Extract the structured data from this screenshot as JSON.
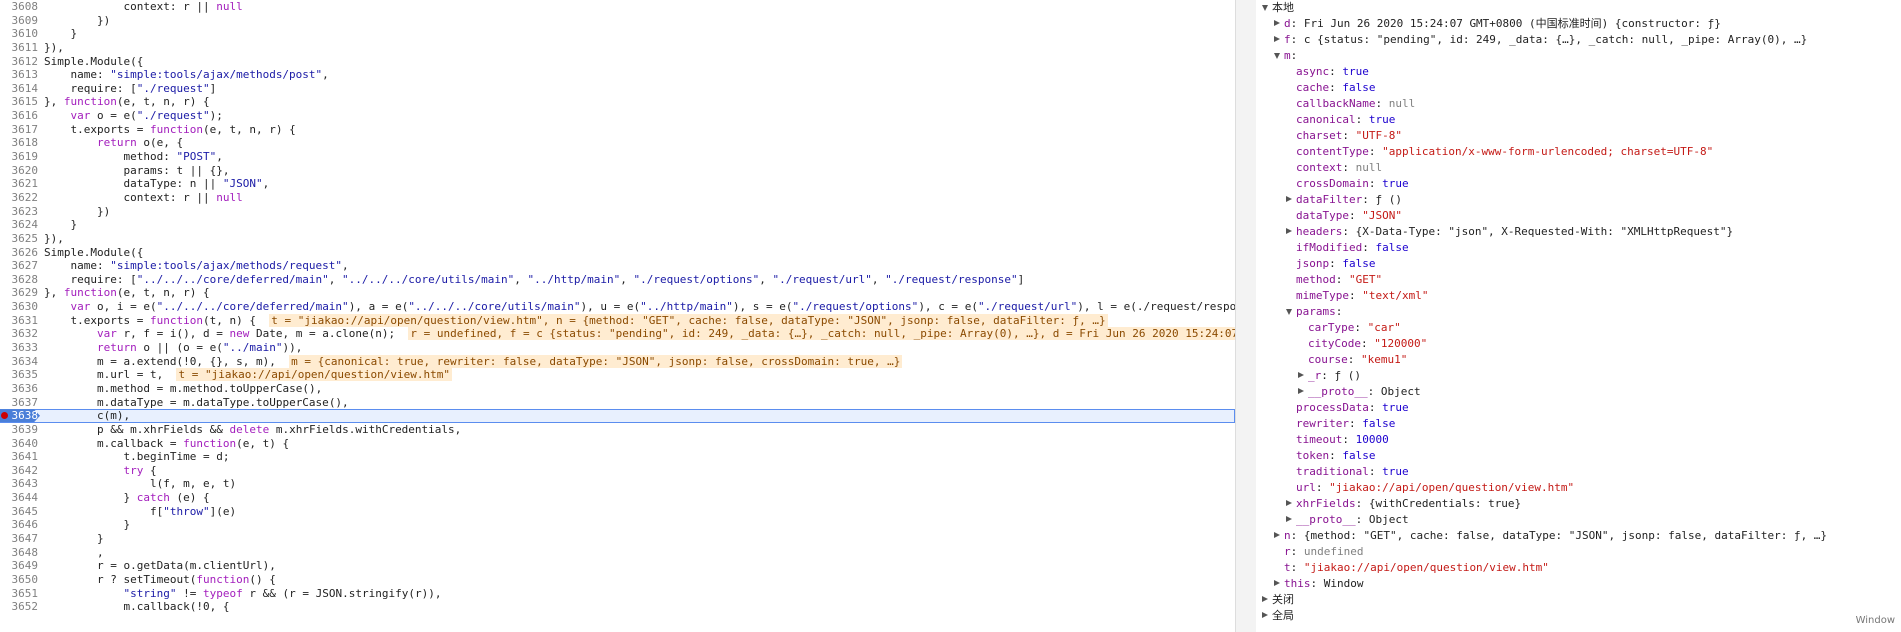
{
  "editor": {
    "current_line": 3638,
    "lines": [
      {
        "n": "3608",
        "t": "            context: r || null"
      },
      {
        "n": "3609",
        "t": "        })"
      },
      {
        "n": "3610",
        "t": "    }"
      },
      {
        "n": "3611",
        "t": "}),"
      },
      {
        "n": "3612",
        "t": "Simple.Module({"
      },
      {
        "n": "3613",
        "t": "    name: \"simple:tools/ajax/methods/post\","
      },
      {
        "n": "3614",
        "t": "    require: [\"./request\"]"
      },
      {
        "n": "3615",
        "t": "}, function(e, t, n, r) {"
      },
      {
        "n": "3616",
        "t": "    var o = e(\"./request\");"
      },
      {
        "n": "3617",
        "t": "    t.exports = function(e, t, n, r) {"
      },
      {
        "n": "3618",
        "t": "        return o(e, {"
      },
      {
        "n": "3619",
        "t": "            method: \"POST\","
      },
      {
        "n": "3620",
        "t": "            params: t || {},"
      },
      {
        "n": "3621",
        "t": "            dataType: n || \"JSON\","
      },
      {
        "n": "3622",
        "t": "            context: r || null"
      },
      {
        "n": "3623",
        "t": "        })"
      },
      {
        "n": "3624",
        "t": "    }"
      },
      {
        "n": "3625",
        "t": "}),"
      },
      {
        "n": "3626",
        "t": "Simple.Module({"
      },
      {
        "n": "3627",
        "t": "    name: \"simple:tools/ajax/methods/request\","
      },
      {
        "n": "3628",
        "t": "    require: [\"../../../core/deferred/main\", \"../../../core/utils/main\", \"../http/main\", \"./request/options\", \"./request/url\", \"./request/response\"]"
      },
      {
        "n": "3629",
        "t": "}, function(e, t, n, r) {"
      },
      {
        "n": "3630",
        "t": "    var o, i = e(\"../../../core/deferred/main\"), a = e(\"../../../core/utils/main\"), u = e(\"../http/main\"), s = e(\"./request/options\"), c = e(\"./request/url\"), l = e(\"./request/respo"
      },
      {
        "n": "3631",
        "t": "    t.exports = function(t, n) {  ",
        "i": "t = \"jiakao://api/open/question/view.htm\", n = {method: \"GET\", cache: false, dataType: \"JSON\", jsonp: false, dataFilter: ƒ, …}"
      },
      {
        "n": "3632",
        "t": "        var r, f = i(), d = new Date, m = a.clone(n);  ",
        "i": "r = undefined, f = c {status: \"pending\", id: 249, _data: {…}, _catch: null, _pipe: Array(0), …}, d = Fri Jun 26 2020 15:24:07"
      },
      {
        "n": "3633",
        "t": "        return o || (o = e(\"../main\")),"
      },
      {
        "n": "3634",
        "t": "        m = a.extend(!0, {}, s, m),  ",
        "i": "m = {canonical: true, rewriter: false, dataType: \"JSON\", jsonp: false, crossDomain: true, …}"
      },
      {
        "n": "3635",
        "t": "        m.url = t,  ",
        "i": "t = \"jiakao://api/open/question/view.htm\""
      },
      {
        "n": "3636",
        "t": "        m.method = m.method.toUpperCase(),"
      },
      {
        "n": "3637",
        "t": "        m.dataType = m.dataType.toUpperCase(),"
      },
      {
        "n": "3638",
        "t": "        c(m),"
      },
      {
        "n": "3639",
        "t": "        p && m.xhrFields && delete m.xhrFields.withCredentials,"
      },
      {
        "n": "3640",
        "t": "        m.callback = function(e, t) {"
      },
      {
        "n": "3641",
        "t": "            t.beginTime = d;"
      },
      {
        "n": "3642",
        "t": "            try {"
      },
      {
        "n": "3643",
        "t": "                l(f, m, e, t)"
      },
      {
        "n": "3644",
        "t": "            } catch (e) {"
      },
      {
        "n": "3645",
        "t": "                f[\"throw\"](e)"
      },
      {
        "n": "3646",
        "t": "            }"
      },
      {
        "n": "3647",
        "t": "        }"
      },
      {
        "n": "3648",
        "t": "        ,"
      },
      {
        "n": "3649",
        "t": "        r = o.getData(m.clientUrl),"
      },
      {
        "n": "3650",
        "t": "        r ? setTimeout(function() {"
      },
      {
        "n": "3651",
        "t": "            \"string\" != typeof r && (r = JSON.stringify(r)),"
      },
      {
        "n": "3652",
        "t": "            m.callback(!0, {"
      }
    ]
  },
  "scope": {
    "rows": [
      {
        "d": 0,
        "tri": "open",
        "k": "本地",
        "sec": true
      },
      {
        "d": 1,
        "tri": "closed",
        "k": "d",
        "v": "Fri Jun 26 2020 15:24:07 GMT+0800 (中国标准时间) {constructor: ƒ}",
        "vt": "obj"
      },
      {
        "d": 1,
        "tri": "closed",
        "k": "f",
        "v": "c {status: \"pending\", id: 249, _data: {…}, _catch: null, _pipe: Array(0), …}",
        "vt": "obj"
      },
      {
        "d": 1,
        "tri": "open",
        "k": "m",
        "v": "",
        "vt": "obj"
      },
      {
        "d": 2,
        "tri": "none",
        "k": "async",
        "v": "true",
        "vt": "bool"
      },
      {
        "d": 2,
        "tri": "none",
        "k": "cache",
        "v": "false",
        "vt": "bool"
      },
      {
        "d": 2,
        "tri": "none",
        "k": "callbackName",
        "v": "null",
        "vt": "obj"
      },
      {
        "d": 2,
        "tri": "none",
        "k": "canonical",
        "v": "true",
        "vt": "bool"
      },
      {
        "d": 2,
        "tri": "none",
        "k": "charset",
        "v": "\"UTF-8\"",
        "vt": "str"
      },
      {
        "d": 2,
        "tri": "none",
        "k": "contentType",
        "v": "\"application/x-www-form-urlencoded; charset=UTF-8\"",
        "vt": "str"
      },
      {
        "d": 2,
        "tri": "none",
        "k": "context",
        "v": "null",
        "vt": "obj"
      },
      {
        "d": 2,
        "tri": "none",
        "k": "crossDomain",
        "v": "true",
        "vt": "bool"
      },
      {
        "d": 2,
        "tri": "closed",
        "k": "dataFilter",
        "v": "ƒ ()",
        "vt": "obj"
      },
      {
        "d": 2,
        "tri": "none",
        "k": "dataType",
        "v": "\"JSON\"",
        "vt": "str"
      },
      {
        "d": 2,
        "tri": "closed",
        "k": "headers",
        "v": "{X-Data-Type: \"json\", X-Requested-With: \"XMLHttpRequest\"}",
        "vt": "obj"
      },
      {
        "d": 2,
        "tri": "none",
        "k": "ifModified",
        "v": "false",
        "vt": "bool"
      },
      {
        "d": 2,
        "tri": "none",
        "k": "jsonp",
        "v": "false",
        "vt": "bool"
      },
      {
        "d": 2,
        "tri": "none",
        "k": "method",
        "v": "\"GET\"",
        "vt": "str"
      },
      {
        "d": 2,
        "tri": "none",
        "k": "mimeType",
        "v": "\"text/xml\"",
        "vt": "str"
      },
      {
        "d": 2,
        "tri": "open",
        "k": "params",
        "v": "",
        "vt": "obj"
      },
      {
        "d": 3,
        "tri": "none",
        "k": "carType",
        "v": "\"car\"",
        "vt": "str"
      },
      {
        "d": 3,
        "tri": "none",
        "k": "cityCode",
        "v": "\"120000\"",
        "vt": "str"
      },
      {
        "d": 3,
        "tri": "none",
        "k": "course",
        "v": "\"kemu1\"",
        "vt": "str"
      },
      {
        "d": 3,
        "tri": "closed",
        "k": "_r",
        "v": "ƒ ()",
        "vt": "obj"
      },
      {
        "d": 3,
        "tri": "closed",
        "k": "__proto__",
        "v": "Object",
        "vt": "obj"
      },
      {
        "d": 2,
        "tri": "none",
        "k": "processData",
        "v": "true",
        "vt": "bool"
      },
      {
        "d": 2,
        "tri": "none",
        "k": "rewriter",
        "v": "false",
        "vt": "bool"
      },
      {
        "d": 2,
        "tri": "none",
        "k": "timeout",
        "v": "10000",
        "vt": "bool"
      },
      {
        "d": 2,
        "tri": "none",
        "k": "token",
        "v": "false",
        "vt": "bool"
      },
      {
        "d": 2,
        "tri": "none",
        "k": "traditional",
        "v": "true",
        "vt": "bool"
      },
      {
        "d": 2,
        "tri": "none",
        "k": "url",
        "v": "\"jiakao://api/open/question/view.htm\"",
        "vt": "str"
      },
      {
        "d": 2,
        "tri": "closed",
        "k": "xhrFields",
        "v": "{withCredentials: true}",
        "vt": "obj"
      },
      {
        "d": 2,
        "tri": "closed",
        "k": "__proto__",
        "v": "Object",
        "vt": "obj"
      },
      {
        "d": 1,
        "tri": "closed",
        "k": "n",
        "v": "{method: \"GET\", cache: false, dataType: \"JSON\", jsonp: false, dataFilter: ƒ, …}",
        "vt": "obj"
      },
      {
        "d": 1,
        "tri": "none",
        "k": "r",
        "v": "undefined",
        "vt": "obj"
      },
      {
        "d": 1,
        "tri": "none",
        "k": "t",
        "v": "\"jiakao://api/open/question/view.htm\"",
        "vt": "str"
      },
      {
        "d": 1,
        "tri": "closed",
        "k": "this",
        "v": "Window",
        "vt": "obj"
      },
      {
        "d": 0,
        "tri": "closed",
        "k": "关闭",
        "sec": true
      },
      {
        "d": 0,
        "tri": "closed",
        "k": "全局",
        "sec": true
      }
    ],
    "window_label": "Window"
  }
}
